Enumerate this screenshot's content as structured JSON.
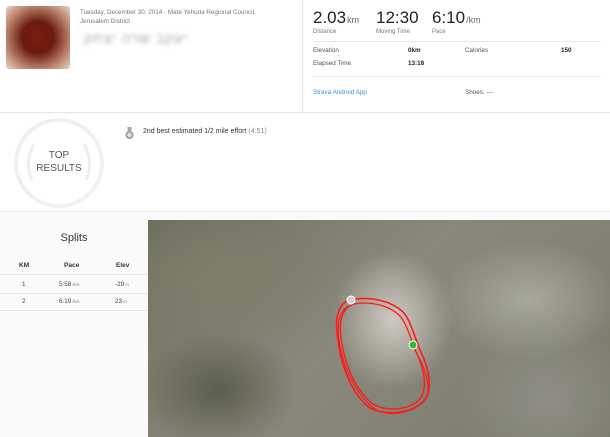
{
  "header": {
    "date_line": "Tuesday, December 30, 2014 · Mate Yehuda Regional Council,",
    "location_line": "Jerusalem District",
    "athlete_name": "יעקב שרה יצחק"
  },
  "stats": {
    "distance": {
      "value": "2.03",
      "unit": "km",
      "label": "Distance"
    },
    "moving_time": {
      "value": "12:30",
      "label": "Moving Time"
    },
    "pace": {
      "value": "6:10",
      "unit": "/km",
      "label": "Pace"
    }
  },
  "details": {
    "elevation_label": "Elevation",
    "elevation_value": "0km",
    "calories_label": "Calories",
    "calories_value": "150",
    "elapsed_label": "Elapsed Time",
    "elapsed_value": "13:18",
    "app_link": "Strava Android App",
    "shoes_label": "Shoes: —"
  },
  "achievements": {
    "badge_line1": "TOP",
    "badge_line2": "RESULTS",
    "item_text": "2nd best estimated 1/2 mile effort",
    "item_value": "(4:51)"
  },
  "splits": {
    "title": "Splits",
    "headers": [
      "KM",
      "Pace",
      "Elev"
    ],
    "rows": [
      {
        "km": "1",
        "pace": "5:58",
        "pace_unit": "/km",
        "elev": "-29",
        "elev_unit": "m"
      },
      {
        "km": "2",
        "pace": "6:19",
        "pace_unit": "/km",
        "elev": "23",
        "elev_unit": "m"
      }
    ]
  },
  "colors": {
    "route": "#ff1a1a",
    "start_marker": "#2dbf2d",
    "end_marker": "#cfcfcf",
    "link": "#3b8fd6"
  }
}
